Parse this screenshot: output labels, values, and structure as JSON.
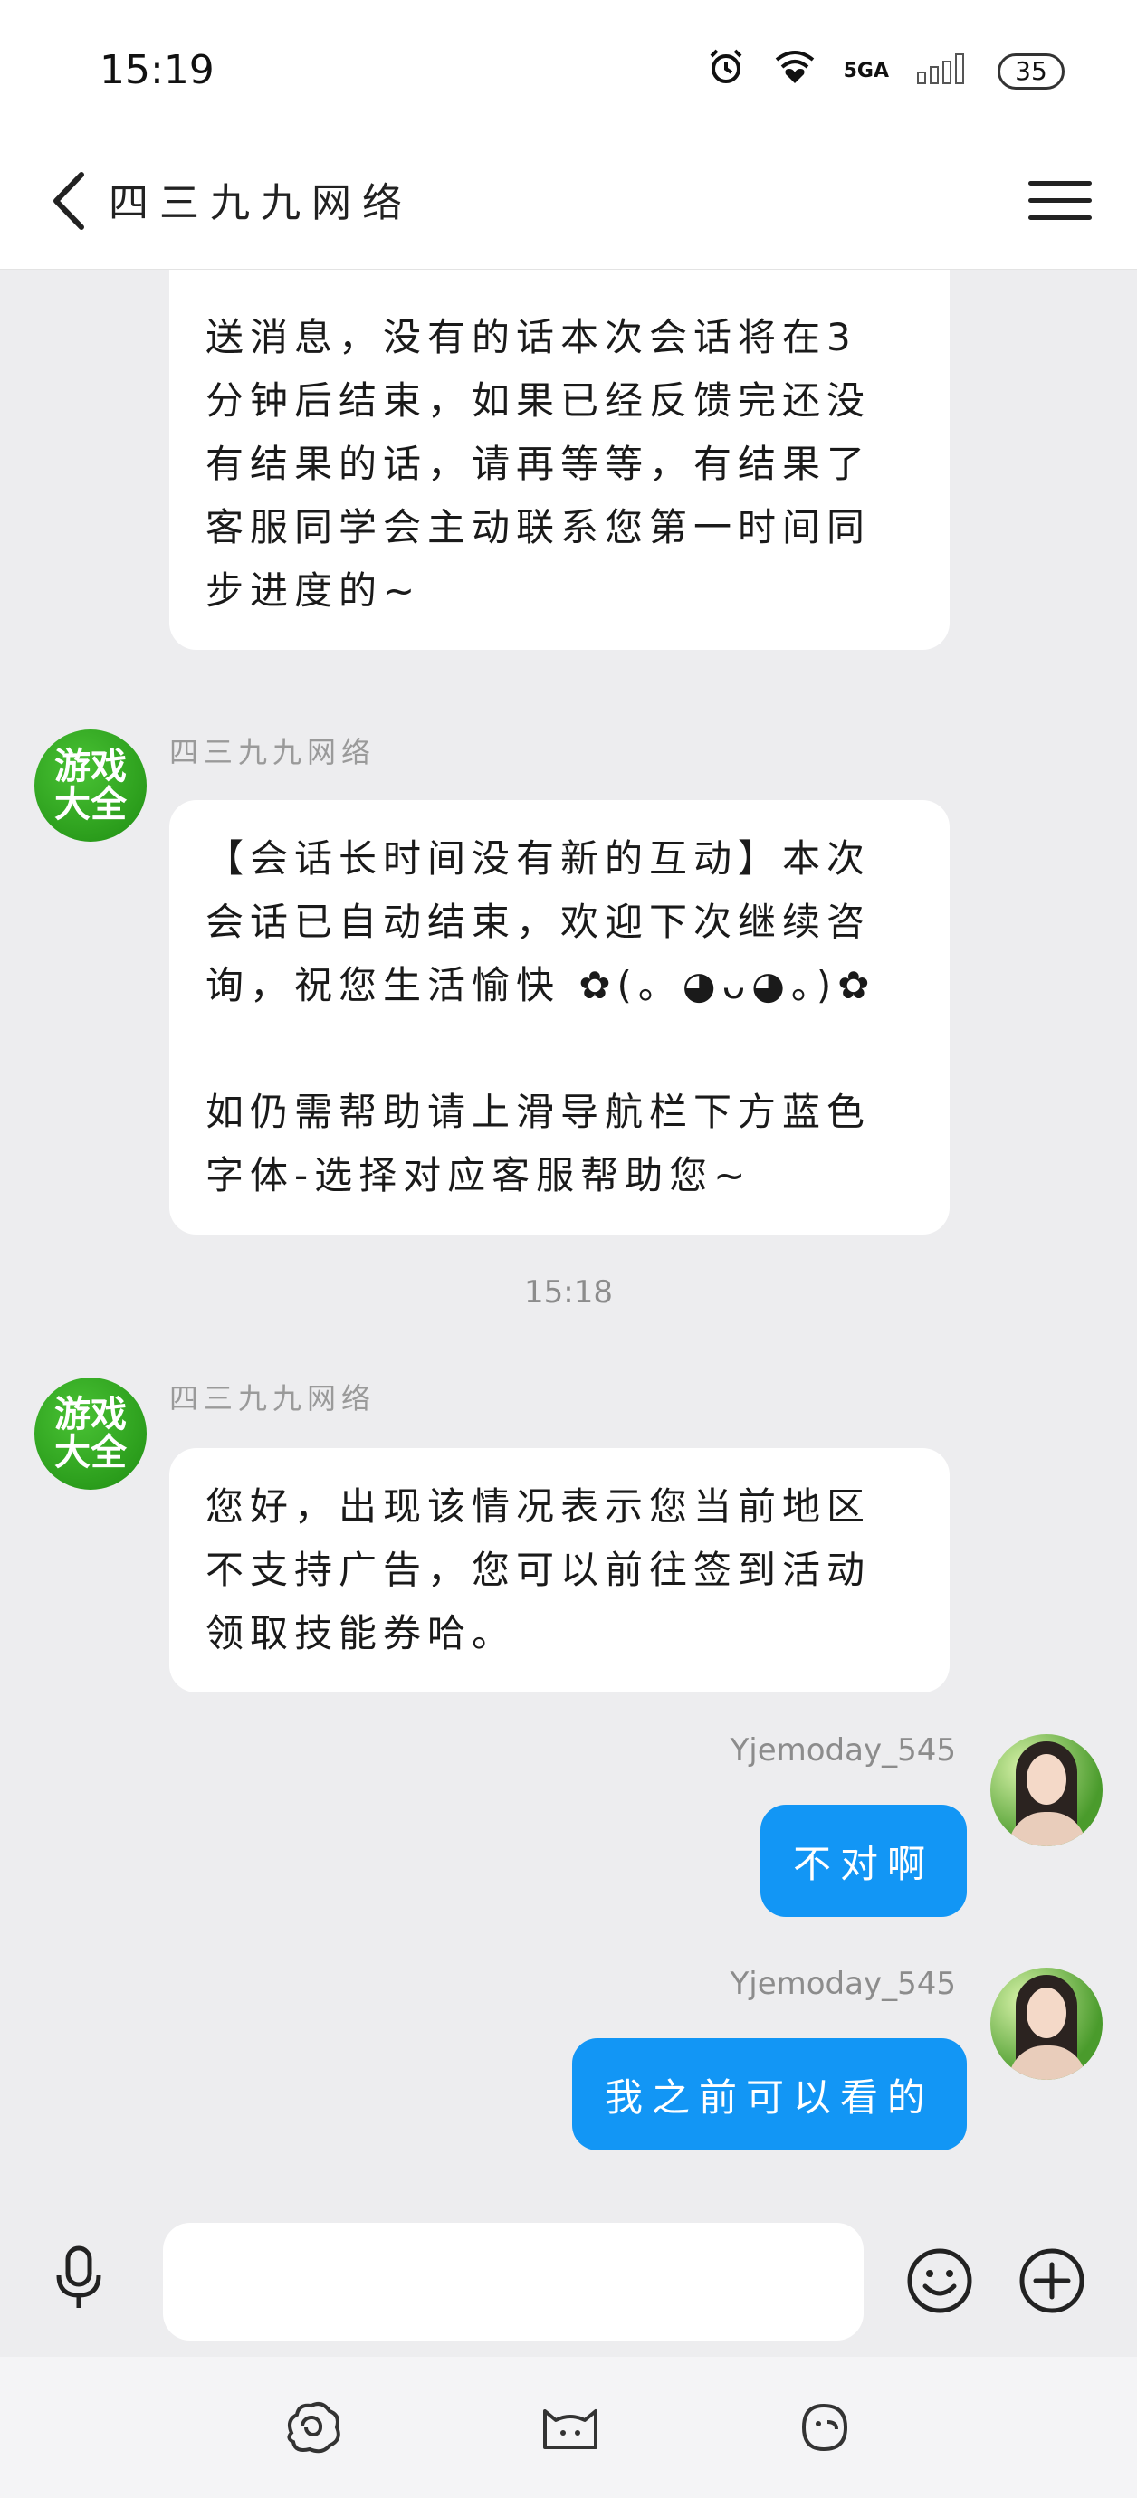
{
  "status_bar": {
    "time": "15:19",
    "network_label": "5GA",
    "battery": "35"
  },
  "header": {
    "title": "四三九九网络"
  },
  "messages": {
    "m1_text": "送消息，没有的话本次会话将在3\n分钟后结束，如果已经反馈完还没\n有结果的话，请再等等，有结果了\n客服同学会主动联系您第一时间同\n步进度的~",
    "m2_sender": "四三九九网络",
    "m2_text": "【会话长时间没有新的互动】本次\n会话已自动结束，欢迎下次继续咨\n询，祝您生活愉快 ✿(。◕ᴗ◕。)✿\n\n如仍需帮助请上滑导航栏下方蓝色\n字体-选择对应客服帮助您~",
    "timestamp": "15:18",
    "m3_sender": "四三九九网络",
    "m3_text": "您好，出现该情况表示您当前地区\n不支持广告，您可以前往签到活动\n领取技能券哈。",
    "m4_sender": "Yjemoday_545",
    "m4_text": "不对啊",
    "m5_sender": "Yjemoday_545",
    "m5_text": "我之前可以看的"
  },
  "bot_avatar": {
    "line1": "游戏",
    "line2": "大全"
  },
  "input": {
    "placeholder": ""
  },
  "colors": {
    "accent": "#1296f5",
    "background": "#ededef",
    "bot_avatar": "#2a9c1a"
  },
  "icons": {
    "back": "chevron-left-icon",
    "menu": "hamburger-menu-icon",
    "mic": "microphone-icon",
    "emoji": "smiley-icon",
    "plus": "plus-circle-icon"
  }
}
